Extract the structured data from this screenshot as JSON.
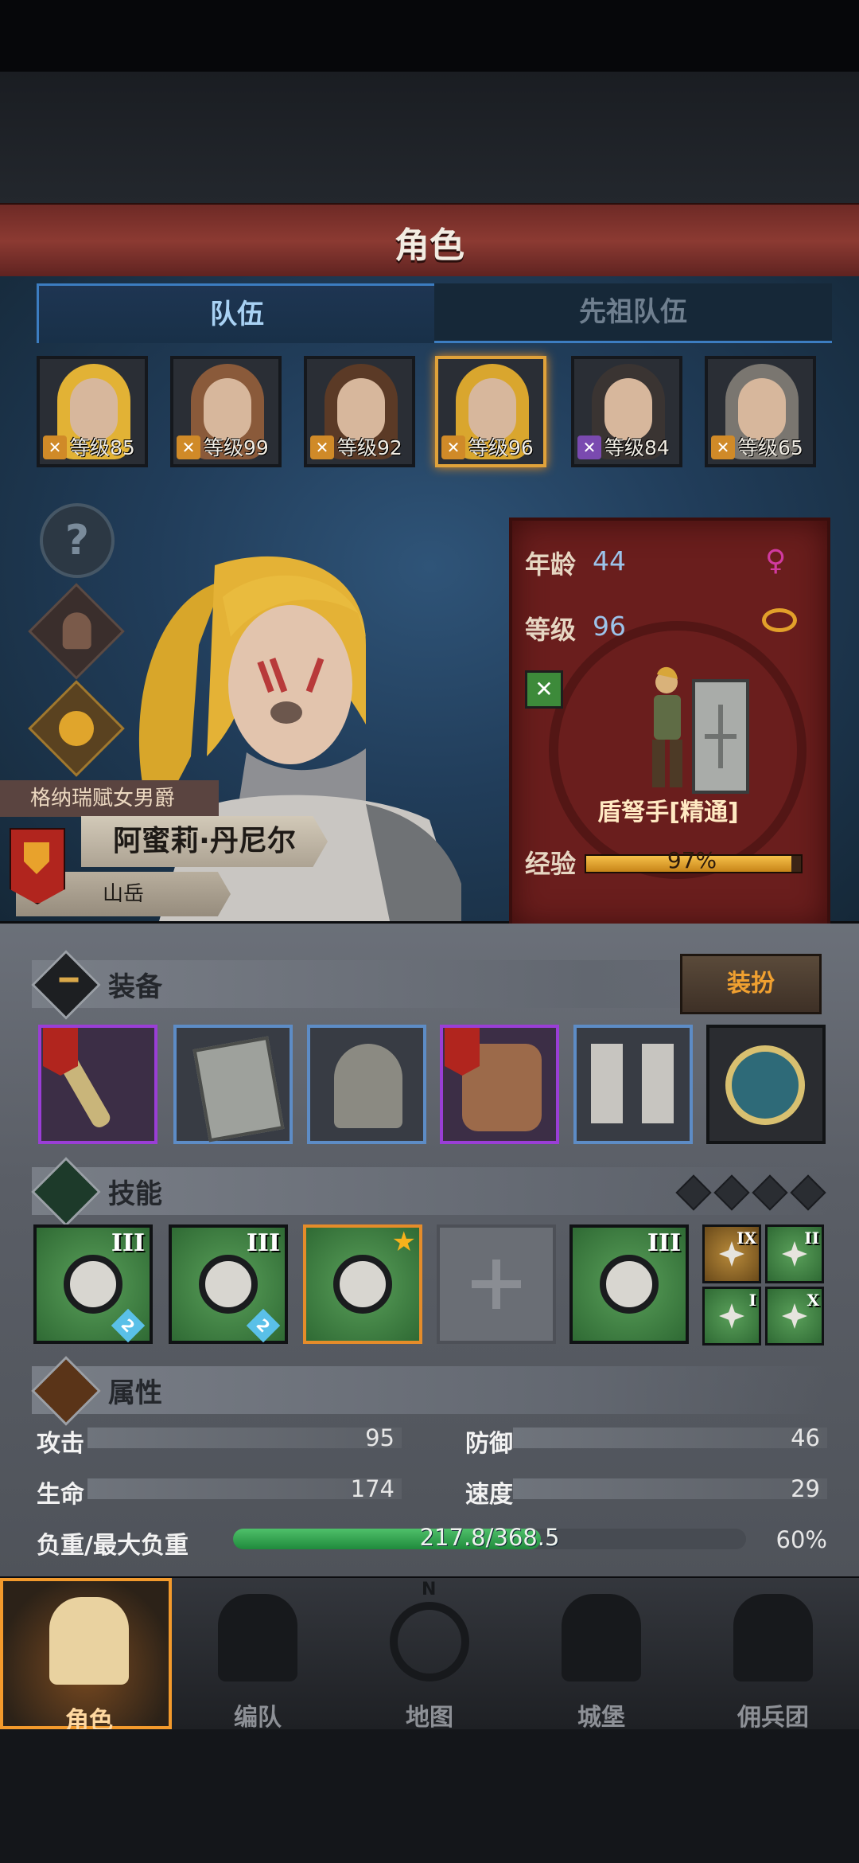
{
  "header": {
    "title": "角色"
  },
  "tabs": [
    {
      "label": "队伍"
    },
    {
      "label": "先祖队伍"
    }
  ],
  "party": [
    {
      "level_text": "等级85",
      "hair": "#e2b235",
      "class_icon_color": "#d08a28"
    },
    {
      "level_text": "等级99",
      "hair": "#8a5a3a",
      "class_icon_color": "#d08a28"
    },
    {
      "level_text": "等级92",
      "hair": "#5b3a26",
      "class_icon_color": "#d08a28"
    },
    {
      "level_text": "等级96",
      "hair": "#d9a62e",
      "class_icon_color": "#d08a28",
      "selected": true
    },
    {
      "level_text": "等级84",
      "hair": "#3a3432",
      "class_icon_color": "#7a4ab0"
    },
    {
      "level_text": "等级65",
      "hair": "#7a7670",
      "class_icon_color": "#d08a28"
    }
  ],
  "side_buttons": [
    {
      "name": "help",
      "glyph": "?"
    },
    {
      "name": "character-portrait",
      "glyph": ""
    },
    {
      "name": "potion",
      "glyph": ""
    }
  ],
  "character": {
    "title": "格纳瑞赋女男爵",
    "name": "阿蜜莉·丹尼尔",
    "sub": "山岳"
  },
  "info": {
    "age_label": "年龄",
    "age": "44",
    "level_label": "等级",
    "level": "96",
    "class_name": "盾弩手[精通]",
    "exp_label": "经验",
    "exp_text": "97%",
    "exp_fraction": 0.97
  },
  "equipment": {
    "title": "装备",
    "dress_button": "装扮",
    "slots": [
      {
        "item": "weapon",
        "rarity": "purple"
      },
      {
        "item": "shield",
        "rarity": "blue"
      },
      {
        "item": "helmet",
        "rarity": "blue"
      },
      {
        "item": "armor",
        "rarity": "purple"
      },
      {
        "item": "boots",
        "rarity": "blue"
      },
      {
        "item": "amulet",
        "rarity": "none"
      }
    ]
  },
  "skills": {
    "title": "技能",
    "main": [
      {
        "roman": "III",
        "badge": "2",
        "icon": "target-icon"
      },
      {
        "roman": "III",
        "badge": "2",
        "icon": "crossbow-icon"
      },
      {
        "roman": "",
        "badge": "",
        "icon": "target-icon",
        "star": true
      },
      {
        "roman": "",
        "badge": "",
        "icon": "empty-slot-icon"
      },
      {
        "roman": "III",
        "badge": "",
        "icon": "crystal-icon"
      }
    ],
    "small": [
      {
        "roman": "IX",
        "icon": "shield-bash-icon"
      },
      {
        "roman": "II",
        "icon": "burst-icon"
      },
      {
        "roman": "I",
        "icon": "burst-icon"
      },
      {
        "roman": "X",
        "icon": "target-icon"
      }
    ]
  },
  "attributes": {
    "title": "属性",
    "attack_label": "攻击",
    "attack": "95",
    "defense_label": "防御",
    "defense": "46",
    "hp_label": "生命",
    "hp": "174",
    "speed_label": "速度",
    "speed": "29",
    "load_label": "负重/最大负重",
    "load": "217.8/368.5",
    "load_percent": "60%",
    "load_fraction": 0.6
  },
  "nav": [
    {
      "label": "角色",
      "active": true
    },
    {
      "label": "编队"
    },
    {
      "label": "地图",
      "compass": "N"
    },
    {
      "label": "城堡"
    },
    {
      "label": "佣兵团"
    }
  ],
  "colors": {
    "accent": "#f39a2c",
    "tab_blue": "#3c7dc1",
    "card_red": "#6a1e1d"
  }
}
